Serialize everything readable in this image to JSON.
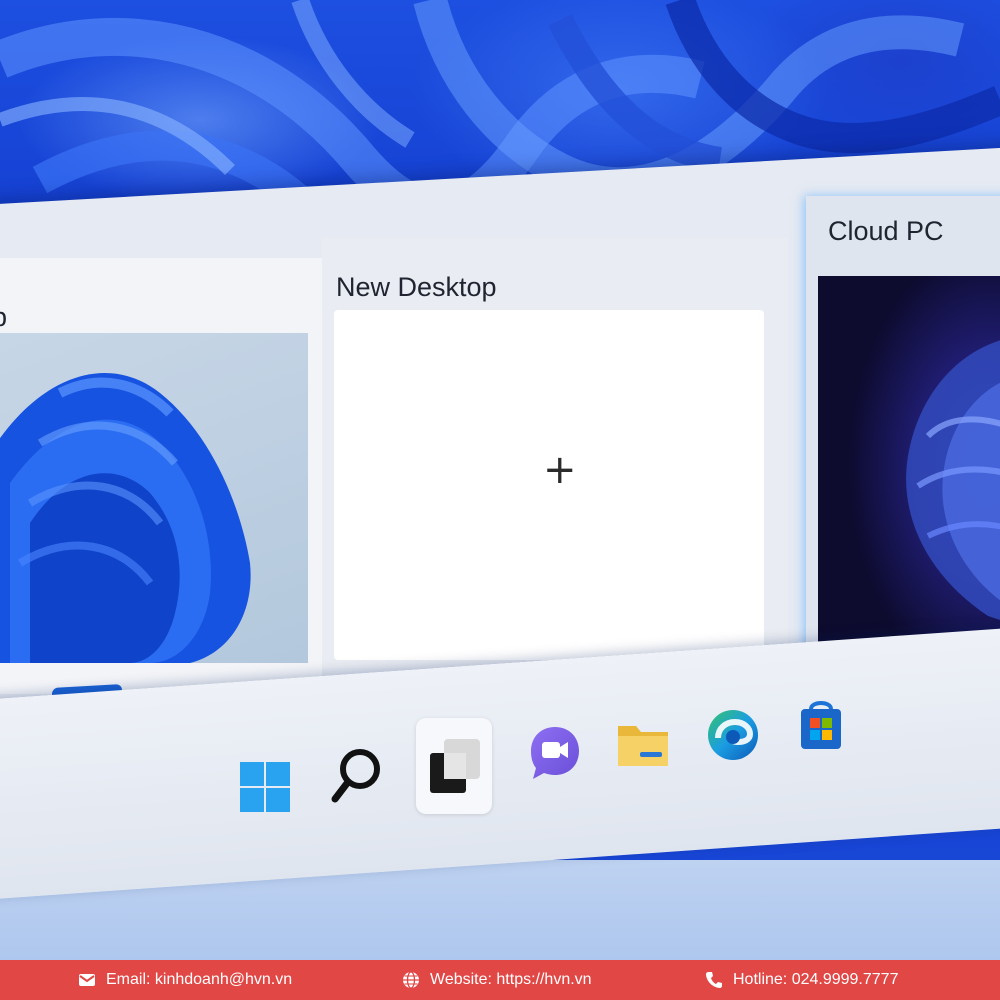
{
  "task_view": {
    "desktops": [
      {
        "label": "p",
        "active": true
      },
      {
        "label": "New Desktop",
        "add_symbol": "+"
      },
      {
        "label": "Cloud PC"
      }
    ]
  },
  "taskbar": {
    "icons": [
      {
        "name": "start-icon"
      },
      {
        "name": "search-icon"
      },
      {
        "name": "task-view-icon",
        "active": true
      },
      {
        "name": "teams-chat-icon"
      },
      {
        "name": "file-explorer-icon"
      },
      {
        "name": "edge-icon"
      },
      {
        "name": "store-icon"
      }
    ]
  },
  "footer": {
    "email": "Email: kinhdoanh@hvn.vn",
    "website": "Website: https://hvn.vn",
    "hotline": "Hotline: 024.9999.7777"
  },
  "colors": {
    "accent": "#1b63d6",
    "footer_bg": "#e14745"
  }
}
